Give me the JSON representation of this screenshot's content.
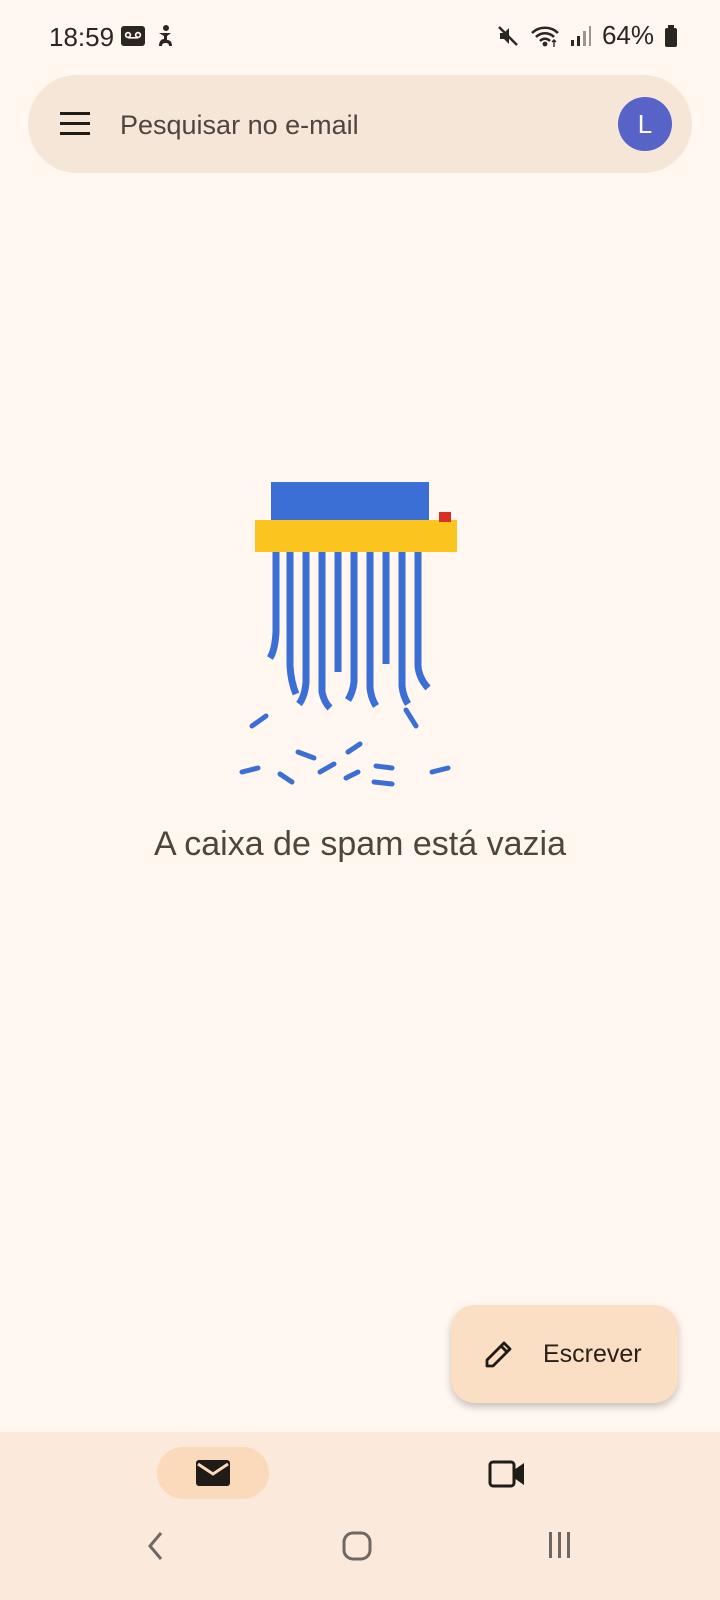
{
  "status_bar": {
    "time": "18:59",
    "battery_percent": "64%",
    "icons": [
      "voicemail-icon",
      "accessibility-icon",
      "mute-icon",
      "wifi-icon",
      "signal-icon",
      "battery-icon"
    ]
  },
  "search": {
    "placeholder": "Pesquisar no e-mail",
    "avatar_letter": "L"
  },
  "empty_state": {
    "message": "A caixa de spam está vazia",
    "illustration": "paper-shredder"
  },
  "fab": {
    "label": "Escrever",
    "icon": "pencil-icon"
  },
  "bottom_nav": {
    "items": [
      {
        "icon": "mail-icon",
        "selected": true
      },
      {
        "icon": "video-camera-icon",
        "selected": false
      }
    ]
  },
  "colors": {
    "background": "#fff7f0",
    "search_bar": "#f6e6d8",
    "avatar": "#5863c8",
    "fab": "#fbdfc4",
    "nav_bar": "#fbeadc",
    "nav_selected_pill": "#fbd9bb",
    "shredder_blue": "#3c6fd6",
    "shredder_yellow": "#fbc41e"
  }
}
